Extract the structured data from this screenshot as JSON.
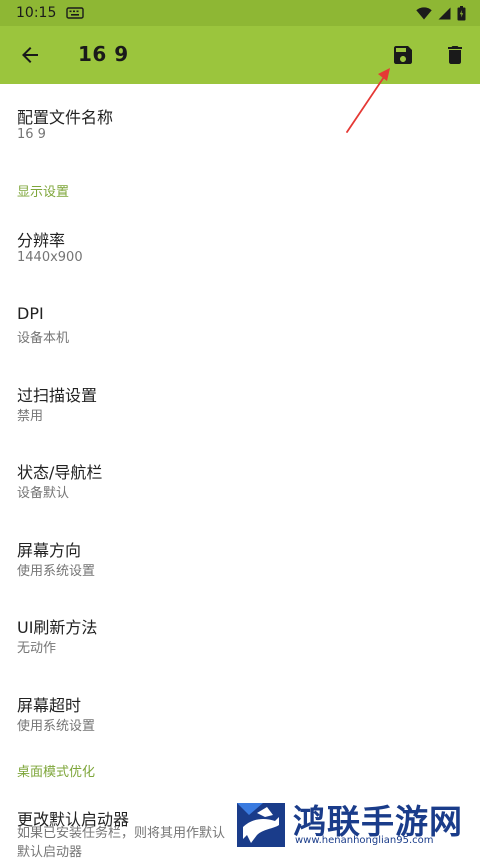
{
  "status_bar": {
    "time": "10:15"
  },
  "app_bar": {
    "title": "16 9",
    "back_icon": "arrow-back-icon",
    "save_icon": "floppy-disk-icon",
    "delete_icon": "trash-icon"
  },
  "profile_name": {
    "title": "配置文件名称",
    "summary": "16 9"
  },
  "display_section": {
    "header": "显示设置",
    "items": [
      {
        "title": "分辨率",
        "summary": "1440x900"
      },
      {
        "title": "DPI",
        "summary": "设备本机"
      },
      {
        "title": "过扫描设置",
        "summary": "禁用"
      },
      {
        "title": "状态/导航栏",
        "summary": "设备默认"
      },
      {
        "title": "屏幕方向",
        "summary": "使用系统设置"
      },
      {
        "title": "UI刷新方法",
        "summary": "无动作"
      },
      {
        "title": "屏幕超时",
        "summary": "使用系统设置"
      }
    ]
  },
  "desktop_section": {
    "header": "桌面模式优化",
    "items": [
      {
        "title": "更改默认启动器",
        "summary": "如果已安装任务栏，则将其用作默认",
        "summary_line2": "默认启动器"
      }
    ]
  },
  "watermark": {
    "name": "鸿联手游网",
    "url": "www.henanhonglian95.com"
  },
  "colors": {
    "status_bar": "#8eb734",
    "app_bar": "#9bc53d",
    "section_header": "#7ea63a",
    "annotation_arrow": "#e53935"
  }
}
